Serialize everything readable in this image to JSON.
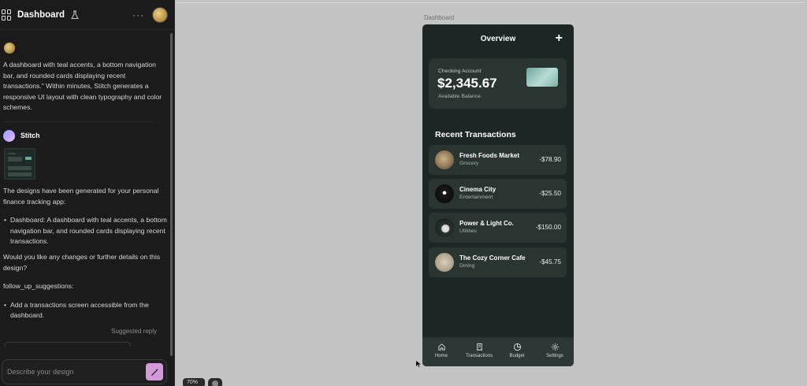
{
  "header": {
    "title": "Dashboard",
    "more_label": "···"
  },
  "chat": {
    "user_message": "A dashboard with teal accents, a bottom navigation bar, and rounded cards displaying recent transactions.\" Within minutes, Stitch generates a responsive UI layout with clean typography and color schemes.",
    "bot_name": "Stitch",
    "bot_intro": "The designs have been generated for your personal finance tracking app:",
    "bot_bullets": [
      "Dashboard: A dashboard with teal accents, a bottom navigation bar, and rounded cards displaying recent transactions."
    ],
    "bot_question": "Would you like any changes or further details on this design?",
    "follow_up_label": "follow_up_suggestions:",
    "follow_up_bullets": [
      "Add a transactions screen accessible from the dashboard."
    ],
    "suggested_reply": "Suggested reply",
    "input_placeholder": "Describe your design"
  },
  "canvas": {
    "frame_label": "Dashboard",
    "zoom": "70%"
  },
  "phone": {
    "title": "Overview",
    "add_symbol": "+",
    "account": {
      "label": "Checking Account",
      "balance": "$2,345.67",
      "sublabel": "Available Balance"
    },
    "recent_title": "Recent Transactions",
    "transactions": [
      {
        "name": "Fresh Foods Market",
        "category": "Grocery",
        "amount": "-$78.90"
      },
      {
        "name": "Cinema City",
        "category": "Entertainment",
        "amount": "-$25.50"
      },
      {
        "name": "Power & Light Co.",
        "category": "Utilities",
        "amount": "-$150.00"
      },
      {
        "name": "The Cozy Corner Cafe",
        "category": "Dining",
        "amount": "-$45.75"
      }
    ],
    "nav": [
      {
        "label": "Home",
        "icon": "home-icon"
      },
      {
        "label": "Transactions",
        "icon": "receipt-icon"
      },
      {
        "label": "Budget",
        "icon": "pie-chart-icon"
      },
      {
        "label": "Settings",
        "icon": "gear-icon"
      }
    ]
  },
  "colors": {
    "panel_bg": "#1b1b1c",
    "phone_bg": "#1c2624",
    "card_bg": "#2a3532",
    "accent": "#d49ad8",
    "canvas_bg": "#c4c4c4"
  }
}
